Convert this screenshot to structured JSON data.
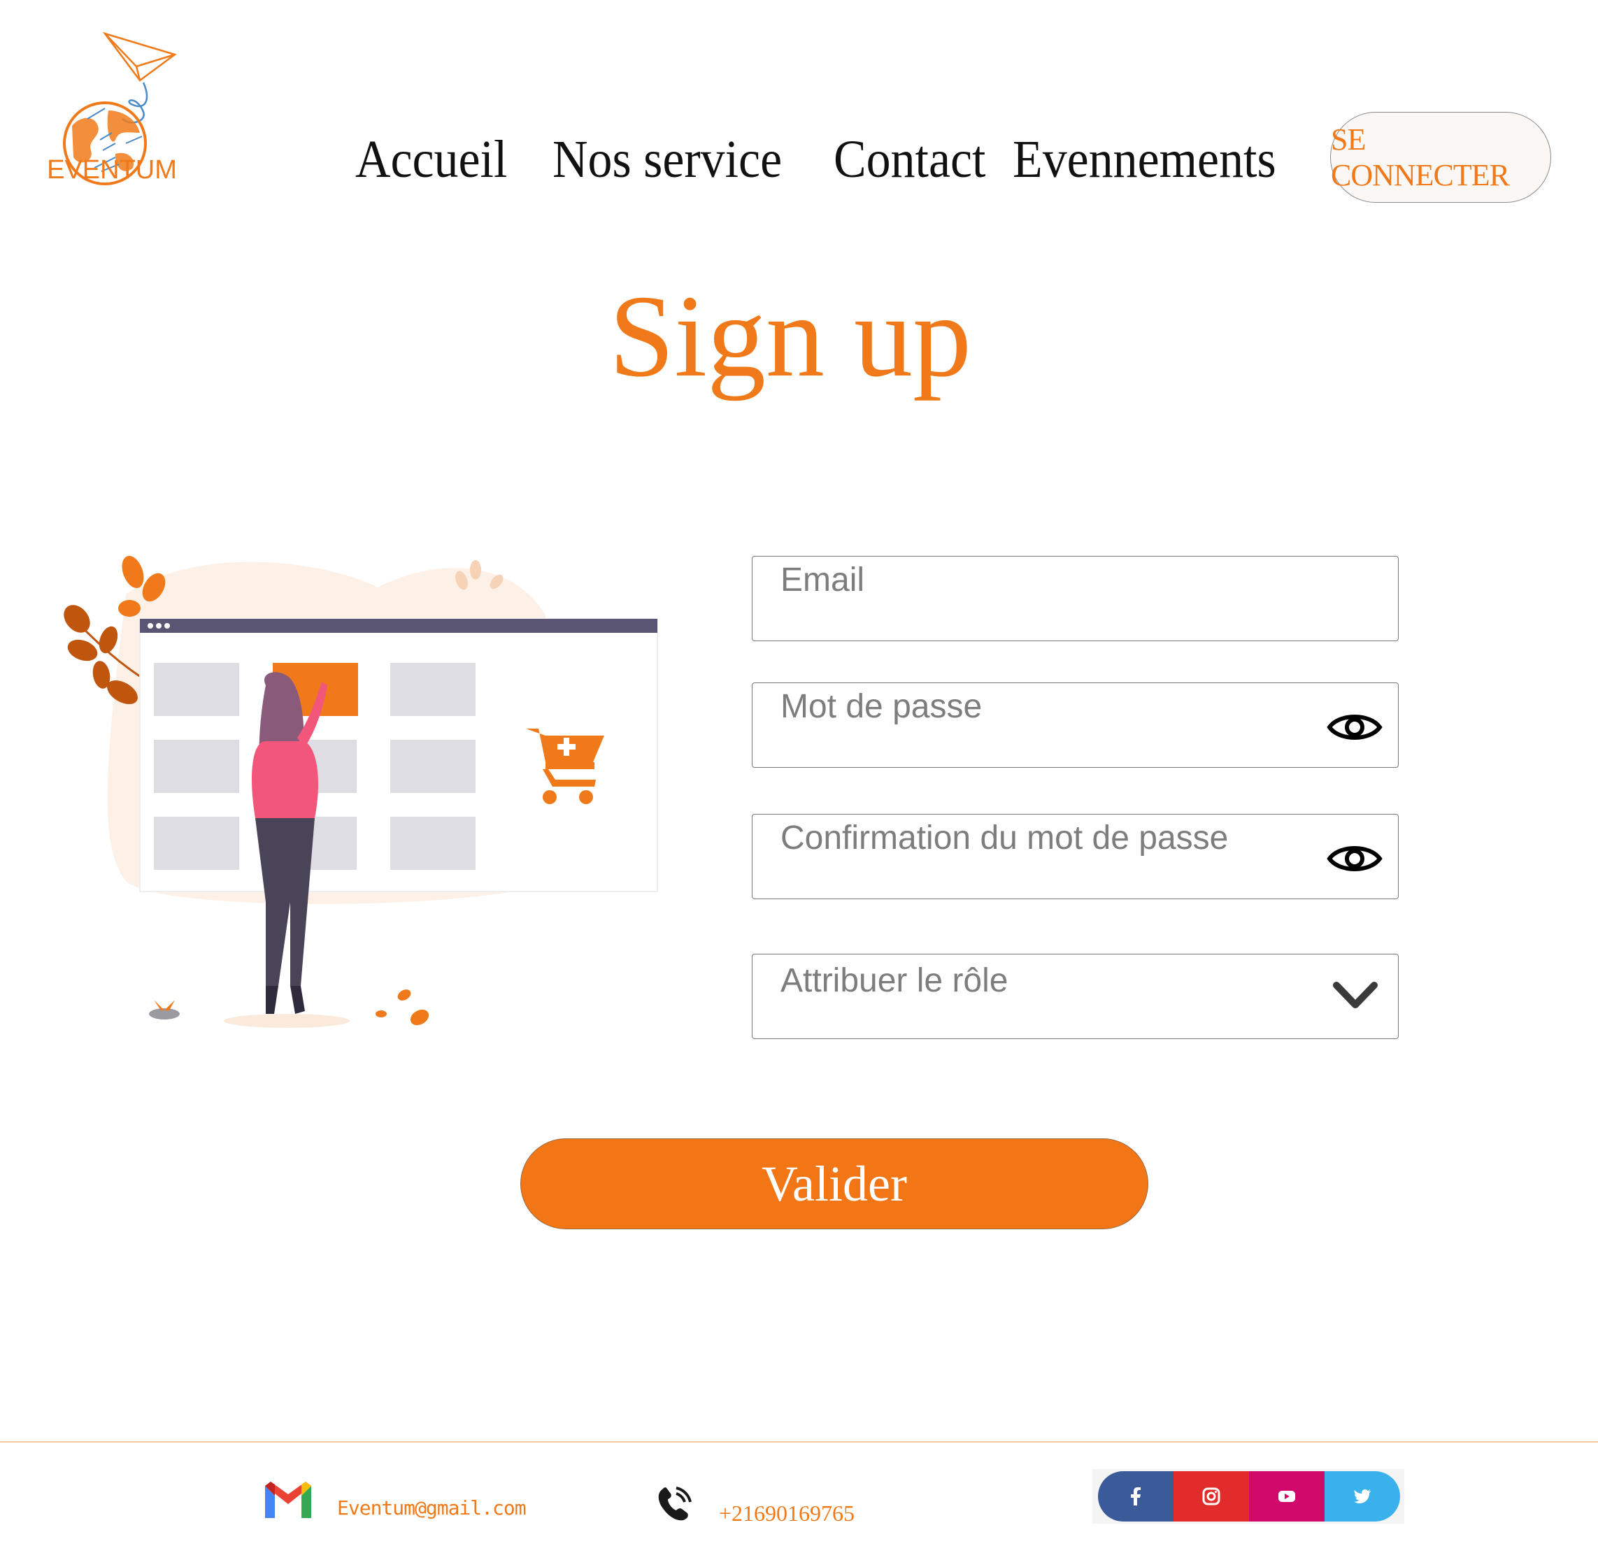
{
  "brand": {
    "name": "EVENTUM",
    "accent_color": "#f07a1a",
    "logo_icon": "globe-paper-plane-logo"
  },
  "nav": {
    "items": [
      "Accueil",
      "Nos service",
      "Contact",
      "Evennements"
    ],
    "connect_label": "SE CONNECTER"
  },
  "page": {
    "title": "Sign up",
    "illustration": "woman-shopping-online-illustration"
  },
  "form": {
    "email_placeholder": "Email",
    "password_placeholder": "Mot de passe",
    "confirm_placeholder": "Confirmation du mot de passe",
    "role_placeholder": "Attribuer le rôle",
    "submit_label": "Valider",
    "submit_color": "#f27616"
  },
  "footer": {
    "email": "Eventum@gmail.com",
    "phone": "+21690169765",
    "social": [
      {
        "icon": "facebook-icon",
        "color": "#3b5a9a"
      },
      {
        "icon": "instagram-icon",
        "color": "#e22c2c"
      },
      {
        "icon": "youtube-icon",
        "color": "#cf0a6a"
      },
      {
        "icon": "twitter-icon",
        "color": "#3ab0ec"
      }
    ]
  }
}
